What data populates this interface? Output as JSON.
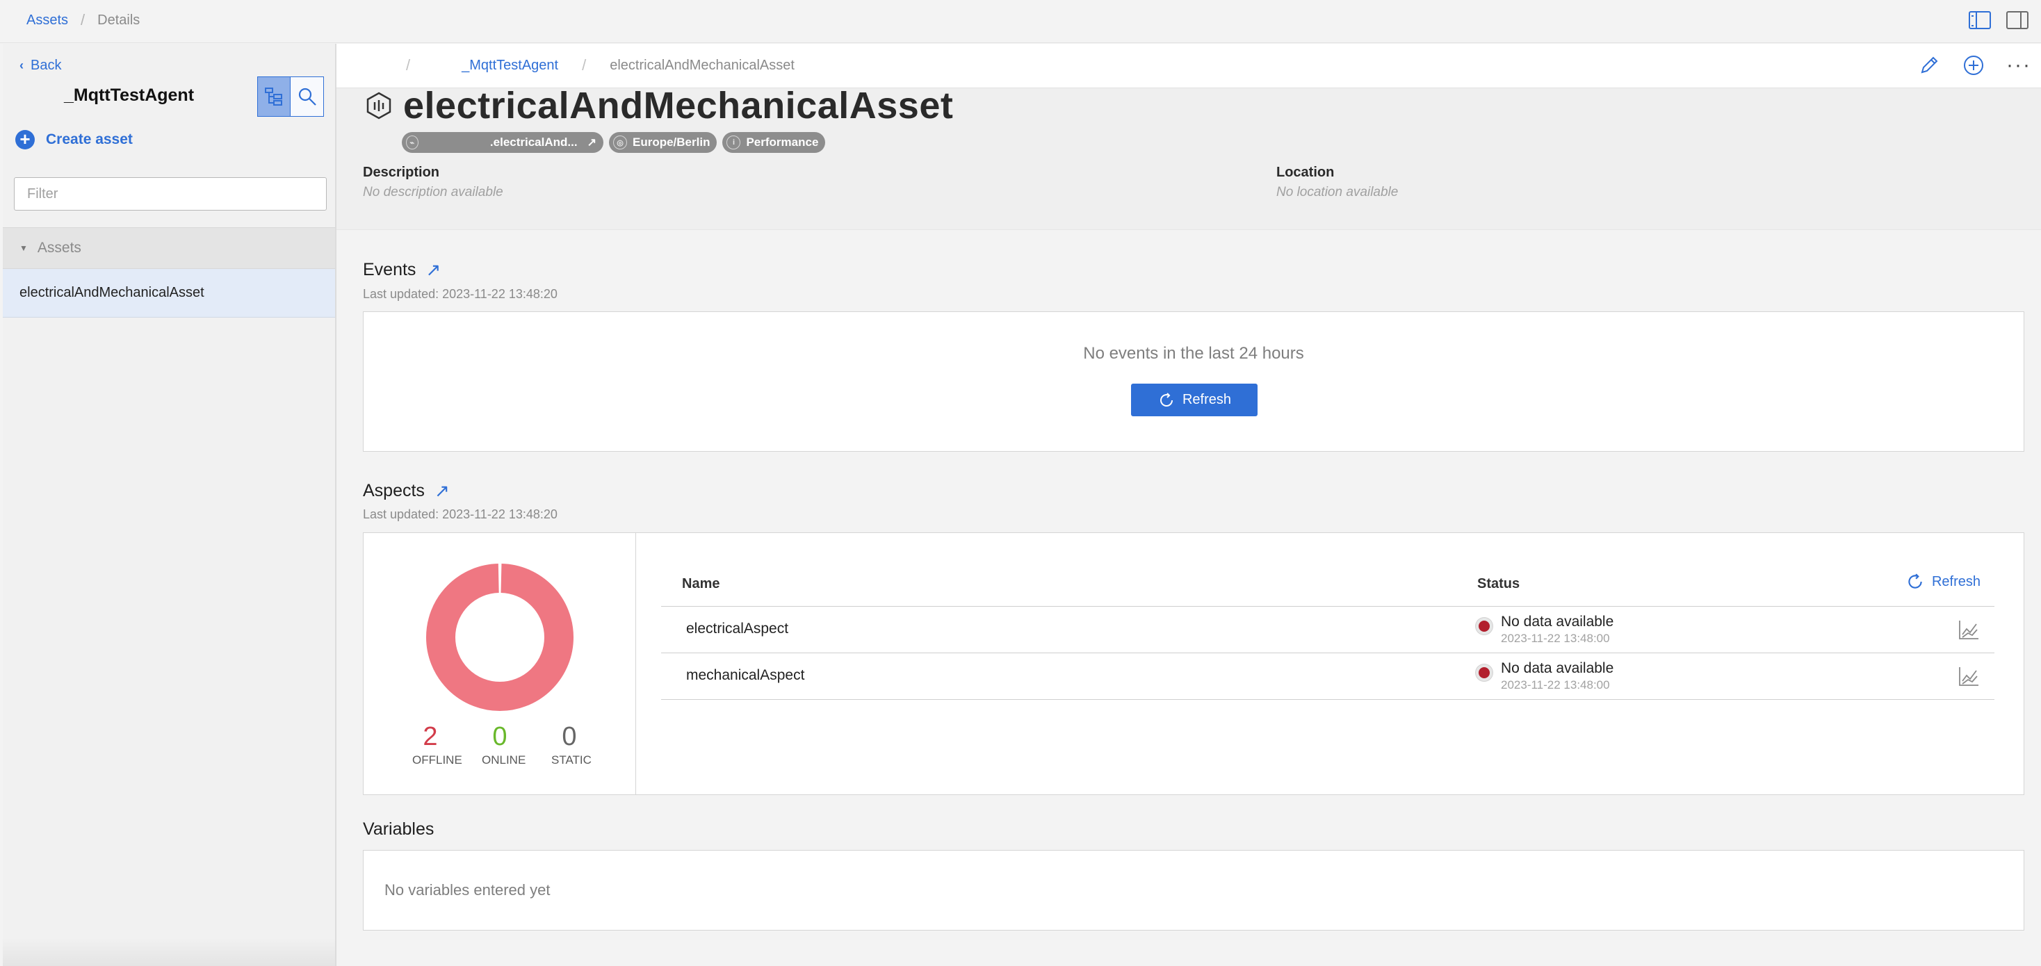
{
  "breadcrumb": {
    "assets": "Assets",
    "details": "Details"
  },
  "sidebar": {
    "back_label": "Back",
    "title": "_MqttTestAgent",
    "create_label": "Create asset",
    "filter_placeholder": "Filter",
    "tree_header": "Assets",
    "tree_items": [
      "electricalAndMechanicalAsset"
    ]
  },
  "main": {
    "breadcrumb": {
      "parent": "_MqttTestAgent",
      "current": "electricalAndMechanicalAsset"
    },
    "asset_name": "electricalAndMechanicalAsset",
    "chips": {
      "asset_id": ".electricalAnd...",
      "timezone": "Europe/Berlin",
      "type": "Performance"
    },
    "description": {
      "label": "Description",
      "value": "No description available"
    },
    "location": {
      "label": "Location",
      "value": "No location available"
    }
  },
  "events": {
    "title": "Events",
    "updated": "Last updated: 2023-11-22 13:48:20",
    "empty": "No events in the last 24 hours",
    "refresh_label": "Refresh"
  },
  "aspects": {
    "title": "Aspects",
    "updated": "Last updated: 2023-11-22 13:48:20",
    "counts": [
      {
        "value": "2",
        "label": "OFFLINE",
        "color": "#d23c4a"
      },
      {
        "value": "0",
        "label": "ONLINE",
        "color": "#69b82b"
      },
      {
        "value": "0",
        "label": "STATIC",
        "color": "#666666"
      }
    ],
    "donut": {
      "offline": 2,
      "online": 0,
      "static": 0,
      "color": "#ef7782"
    },
    "columns": {
      "name": "Name",
      "status": "Status"
    },
    "refresh_label": "Refresh",
    "rows": [
      {
        "name": "electricalAspect",
        "status": "No data available",
        "time": "2023-11-22 13:48:00"
      },
      {
        "name": "mechanicalAspect",
        "status": "No data available",
        "time": "2023-11-22 13:48:00"
      }
    ]
  },
  "variables": {
    "title": "Variables",
    "empty": "No variables entered yet"
  },
  "colors": {
    "accent": "#2f6fd6",
    "offline": "#d23c4a",
    "online": "#69b82b"
  }
}
